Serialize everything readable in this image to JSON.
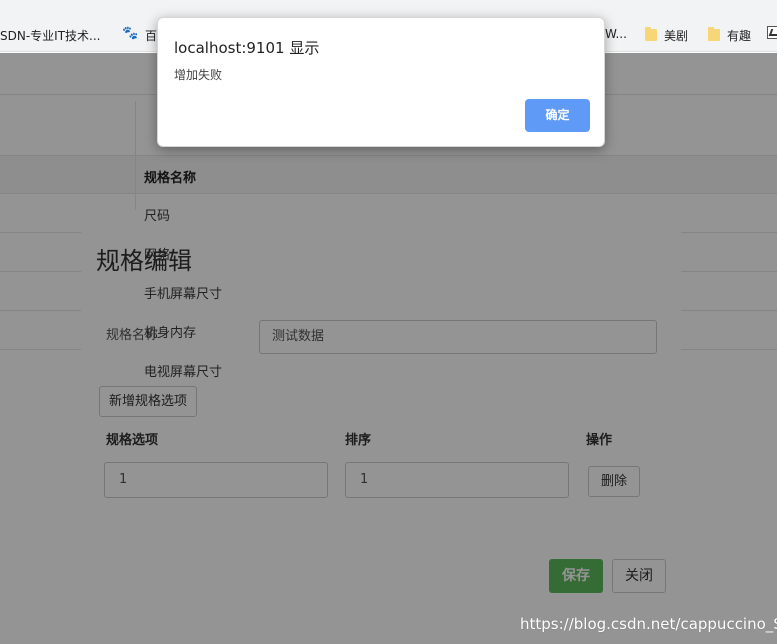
{
  "bookmarks": {
    "csdn": "SDN-专业IT技术...",
    "baidu_partial": "百",
    "w_partial": "W...",
    "folder1": "美剧",
    "folder2": "有趣"
  },
  "table": {
    "header": "规格名称",
    "rows": [
      "尺码",
      "网络",
      "手机屏幕尺寸",
      "机身内存",
      "电视屏幕尺寸"
    ]
  },
  "modal": {
    "title": "规格编辑",
    "name_label": "规格名称",
    "name_value": "测试数据",
    "add_option_label": "新增规格选项",
    "col_option": "规格选项",
    "col_sort": "排序",
    "col_action": "操作",
    "option_value": "1",
    "sort_value": "1",
    "delete_label": "删除",
    "save_label": "保存",
    "close_label": "关闭"
  },
  "alert": {
    "title": "localhost:9101 显示",
    "message": "增加失败",
    "ok_label": "确定"
  },
  "watermark": "https://blog.csdn.net/cappuccino_S",
  "colors": {
    "alert_ok": "#5f9bf6",
    "save": "#5cb85c"
  }
}
